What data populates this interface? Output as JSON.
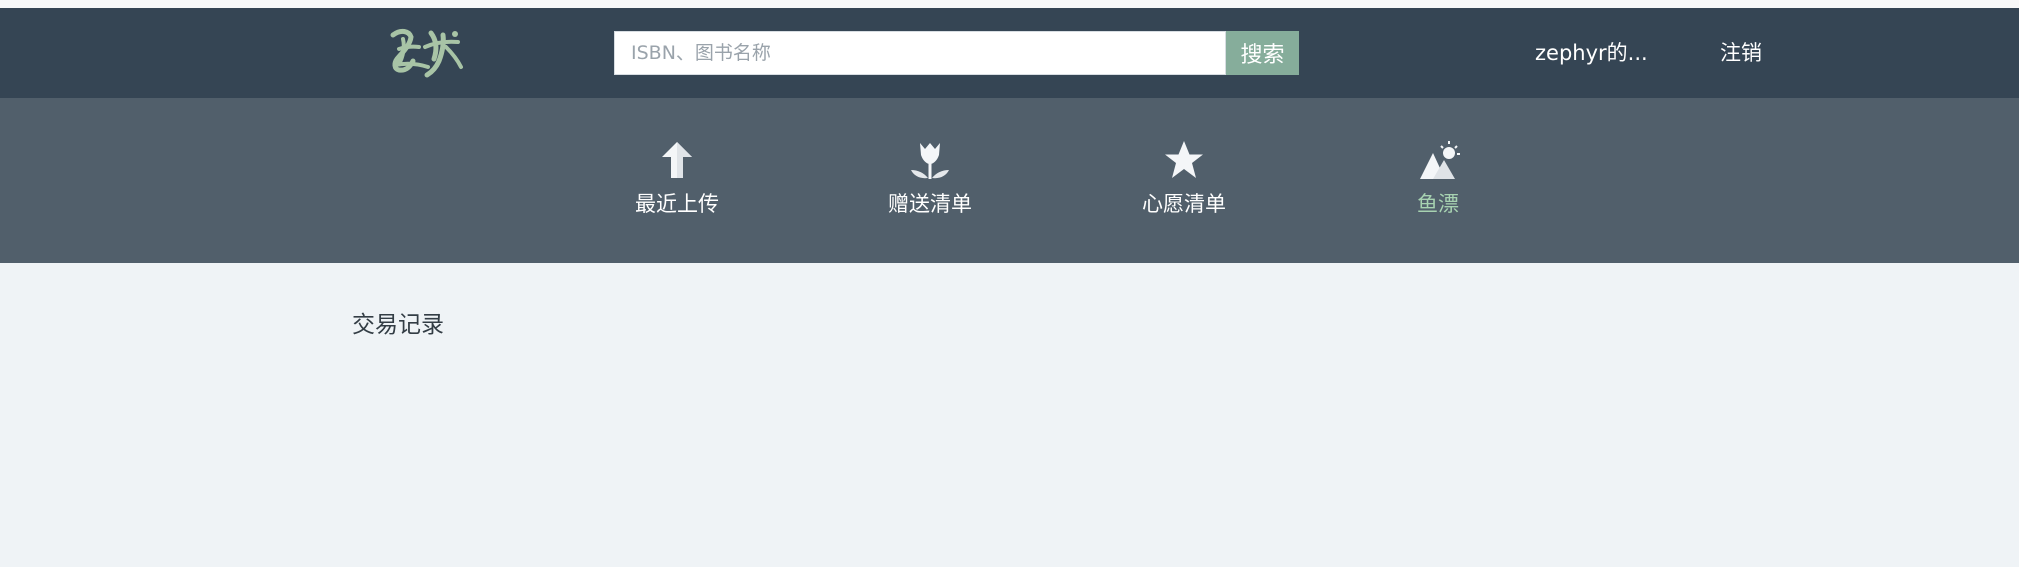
{
  "header": {
    "logo_icon": "yushu-calligraphy-logo",
    "search": {
      "placeholder": "ISBN、图书名称",
      "value": "",
      "button_label": "搜索"
    },
    "user": {
      "name": "zephyr的...",
      "logout_label": "注销"
    }
  },
  "nav": {
    "items": [
      {
        "label": "最近上传",
        "icon": "arrow-up-icon",
        "active": false
      },
      {
        "label": "赠送清单",
        "icon": "tulip-icon",
        "active": false
      },
      {
        "label": "心愿清单",
        "icon": "star-icon",
        "active": false
      },
      {
        "label": "鱼漂",
        "icon": "mountains-sun-icon",
        "active": true
      }
    ]
  },
  "main": {
    "title": "交易记录"
  },
  "colors": {
    "header_bg": "#354554",
    "nav_bg": "#515f6b",
    "search_button_bg": "#86ad9b",
    "active_nav_text": "#a7d2b1",
    "page_bg": "#eff3f6"
  }
}
